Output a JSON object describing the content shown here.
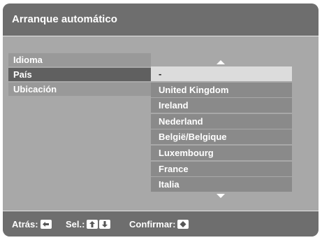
{
  "window": {
    "title": "Arranque automático"
  },
  "menu": {
    "items": [
      {
        "label": "Idioma"
      },
      {
        "label": "País"
      },
      {
        "label": "Ubicación"
      }
    ]
  },
  "countries": {
    "items": [
      {
        "label": "-"
      },
      {
        "label": "United Kingdom"
      },
      {
        "label": "Ireland"
      },
      {
        "label": "Nederland"
      },
      {
        "label": "België/Belgique"
      },
      {
        "label": "Luxembourg"
      },
      {
        "label": "France"
      },
      {
        "label": "Italia"
      }
    ]
  },
  "footer": {
    "back_label": "Atrás:",
    "select_label": "Sel.:",
    "confirm_label": "Confirmar:"
  },
  "colors": {
    "background": "#a8a8a8",
    "bar": "#6e6e6e",
    "selected_menu": "#606060",
    "list_item": "#8a8a8a",
    "selected_list_item": "#dcdcdc"
  },
  "icons": {
    "back_key": "left-arrow-key-icon",
    "up_key": "up-arrow-key-icon",
    "down_key": "down-arrow-key-icon",
    "confirm_key": "center-key-icon",
    "scroll_up": "scroll-up-icon",
    "scroll_down": "scroll-down-icon"
  }
}
